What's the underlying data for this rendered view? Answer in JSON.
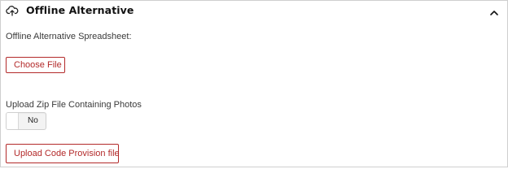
{
  "section": {
    "title": "Offline Alternative",
    "header_icon": "cloud-upload-icon",
    "collapse_icon": "chevron-up-icon"
  },
  "spreadsheet": {
    "label": "Offline Alternative Spreadsheet:",
    "choose_file_label": "Choose File"
  },
  "zip_upload": {
    "label": "Upload Zip File Containing Photos",
    "toggle_value": "No"
  },
  "code_provision": {
    "button_label": "Upload Code Provision file"
  },
  "colors": {
    "accent": "#b32a2a",
    "border": "#cfcfcf",
    "text": "#333333"
  }
}
